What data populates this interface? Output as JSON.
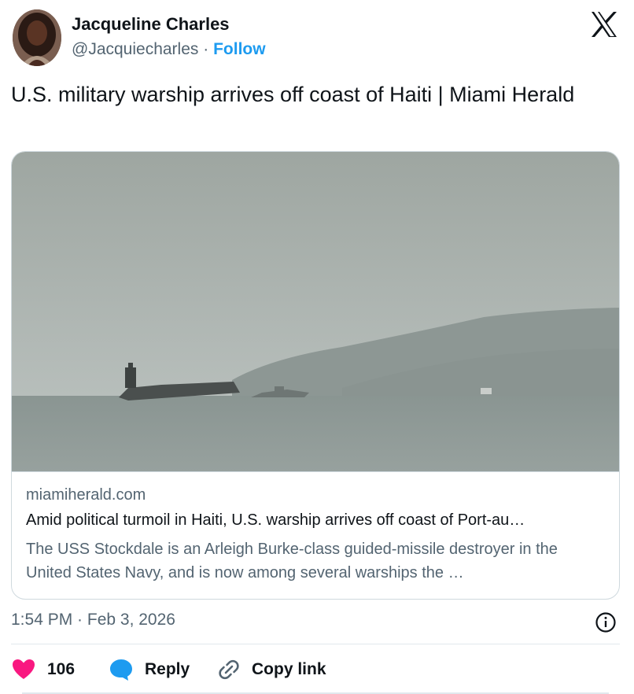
{
  "author": {
    "name": "Jacqueline Charles",
    "handle": "@Jacquiecharles",
    "separator": "·",
    "follow_label": "Follow"
  },
  "platform_icon": "x-logo-icon",
  "tweet": {
    "text": "U.S. military warship arrives off coast of Haiti | Miami Herald"
  },
  "link_card": {
    "domain": "miamiherald.com",
    "title": "Amid political turmoil in Haiti, U.S. warship arrives off coast of Port-au…",
    "description": "The USS Stockdale is an Arleigh Burke-class guided-missile destroyer in the United States Navy, and is now among several warships the …"
  },
  "timestamp": "1:54 PM · Feb 3, 2026",
  "actions": {
    "like_count": "106",
    "reply_label": "Reply",
    "copy_label": "Copy link"
  },
  "colors": {
    "accent": "#1d9bf0",
    "like": "#f91880",
    "text": "#0f1419",
    "secondary": "#536471"
  }
}
